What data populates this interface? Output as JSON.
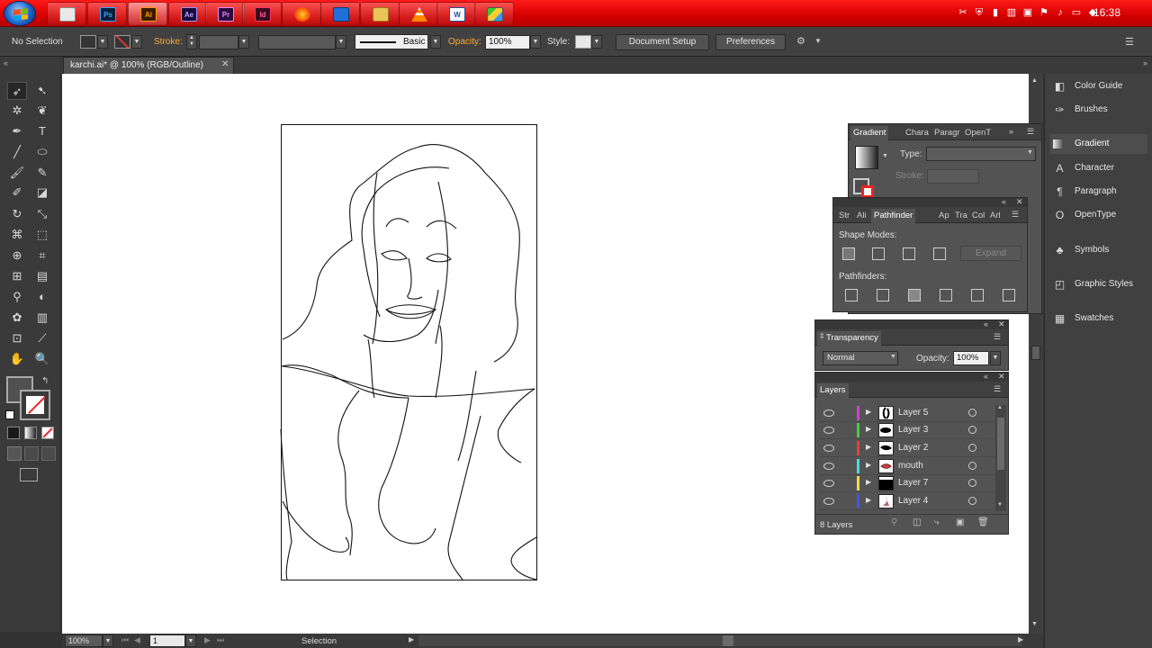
{
  "taskbar": {
    "apps": [
      {
        "icon": "folder-app-icon",
        "label": ""
      },
      {
        "icon": "photoshop-icon",
        "label": "Ps"
      },
      {
        "icon": "illustrator-icon",
        "label": "Ai"
      },
      {
        "icon": "after-effects-icon",
        "label": "Ae"
      },
      {
        "icon": "premiere-icon",
        "label": "Pr"
      },
      {
        "icon": "indesign-icon",
        "label": "Id"
      },
      {
        "icon": "firefox-icon",
        "label": ""
      },
      {
        "icon": "network-icon",
        "label": ""
      },
      {
        "icon": "explorer-icon",
        "label": ""
      },
      {
        "icon": "vlc-icon",
        "label": ""
      },
      {
        "icon": "word-icon",
        "label": "W"
      },
      {
        "icon": "paint-icon",
        "label": ""
      }
    ],
    "clock": "16:38"
  },
  "control": {
    "selection": "No Selection",
    "stroke_label": "Stroke:",
    "brush": "Basic",
    "opacity_label": "Opacity:",
    "opacity_value": "100%",
    "style_label": "Style:",
    "doc_setup": "Document Setup",
    "preferences": "Preferences"
  },
  "document": {
    "tab_title": "karchi.ai* @ 100% (RGB/Outline)"
  },
  "status": {
    "zoom": "100%",
    "artboard": "1",
    "tool": "Selection"
  },
  "gradient_panel": {
    "tabs": [
      "Gradient",
      "Chara",
      "Paragr",
      "OpenT"
    ],
    "type_label": "Type:",
    "stroke_label": "Stroke:"
  },
  "pathfinder_panel": {
    "tabs": [
      "Str",
      "Ali",
      "Pathfinder",
      "Ap",
      "Tra",
      "Col",
      "Arl"
    ],
    "shape_modes": "Shape Modes:",
    "expand": "Expand",
    "pathfinders": "Pathfinders:"
  },
  "transparency_panel": {
    "title": "Transparency",
    "blend_mode": "Normal",
    "opacity_label": "Opacity:",
    "opacity_value": "100%"
  },
  "layers_panel": {
    "title": "Layers",
    "layers": [
      {
        "name": "Layer 5",
        "color": "#cc44cc"
      },
      {
        "name": "Layer 3",
        "color": "#44cc44"
      },
      {
        "name": "Layer 2",
        "color": "#dd4444"
      },
      {
        "name": "mouth",
        "color": "#44dddd"
      },
      {
        "name": "Layer 7",
        "color": "#eedd44"
      },
      {
        "name": "Layer 4",
        "color": "#4455dd"
      }
    ],
    "count": "8 Layers"
  },
  "dock": {
    "items": [
      {
        "label": "Color Guide",
        "icon": "color-guide-icon"
      },
      {
        "label": "Brushes",
        "icon": "brushes-icon"
      },
      {
        "label": "Gradient",
        "icon": "gradient-icon"
      },
      {
        "label": "Character",
        "icon": "character-icon"
      },
      {
        "label": "Paragraph",
        "icon": "paragraph-icon"
      },
      {
        "label": "OpenType",
        "icon": "opentype-icon"
      },
      {
        "label": "Symbols",
        "icon": "symbols-icon"
      },
      {
        "label": "Graphic Styles",
        "icon": "graphic-styles-icon"
      },
      {
        "label": "Swatches",
        "icon": "swatches-icon"
      }
    ]
  }
}
